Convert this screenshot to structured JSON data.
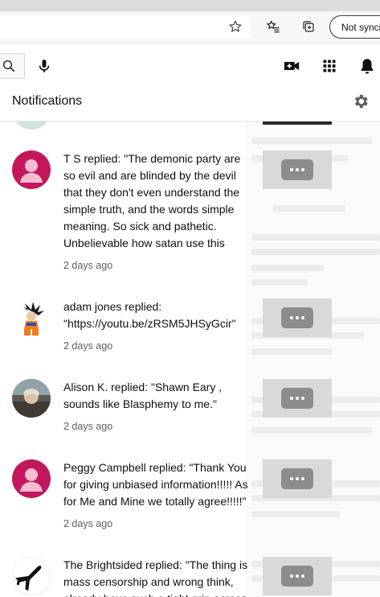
{
  "browser": {
    "sync_label": "Not syncing",
    "icons": [
      "star-icon",
      "favorites-icon",
      "collections-icon"
    ]
  },
  "header": {
    "icons": [
      "search-icon",
      "mic-icon",
      "create-video-icon",
      "apps-grid-icon",
      "bell-icon"
    ]
  },
  "notifications": {
    "title": "Notifications",
    "settings_icon": "gear-icon",
    "items": [
      {
        "avatar_type": "default-pink",
        "text": "T S replied: \"The demonic party are so evil and are blinded by the devil that they don't even understand the simple truth, and the words simple meaning. So sick and pathetic. Unbelievable how satan use this",
        "time": "2 days ago"
      },
      {
        "avatar_type": "goku-character",
        "text": "adam jones replied: \"https://youtu.be/zRSM5JHSyGcir\"",
        "time": "2 days ago"
      },
      {
        "avatar_type": "photo-person",
        "text": "Alison K. replied: \"Shawn Eary , sounds like Blasphemy to me.\"",
        "time": "2 days ago"
      },
      {
        "avatar_type": "default-pink",
        "text": "Peggy Campbell replied: \"Thank You for giving unbiased information!!!!! As for Me and Mine we totally agree!!!!!\"",
        "time": "2 days ago"
      },
      {
        "avatar_type": "airplane-logo",
        "text": "The Brightsided replied: \"The thing is mass censorship and wrong think, already have such a tight grip across",
        "time": ""
      }
    ]
  },
  "colors": {
    "avatar_pink": "#c2185b",
    "avatar_pink_light": "#f8bbd0",
    "thumb_bg": "#d9d9d9",
    "thumb_dots_bg": "#8c8c8c",
    "text_primary": "#0f0f0f",
    "text_secondary": "#606060"
  }
}
